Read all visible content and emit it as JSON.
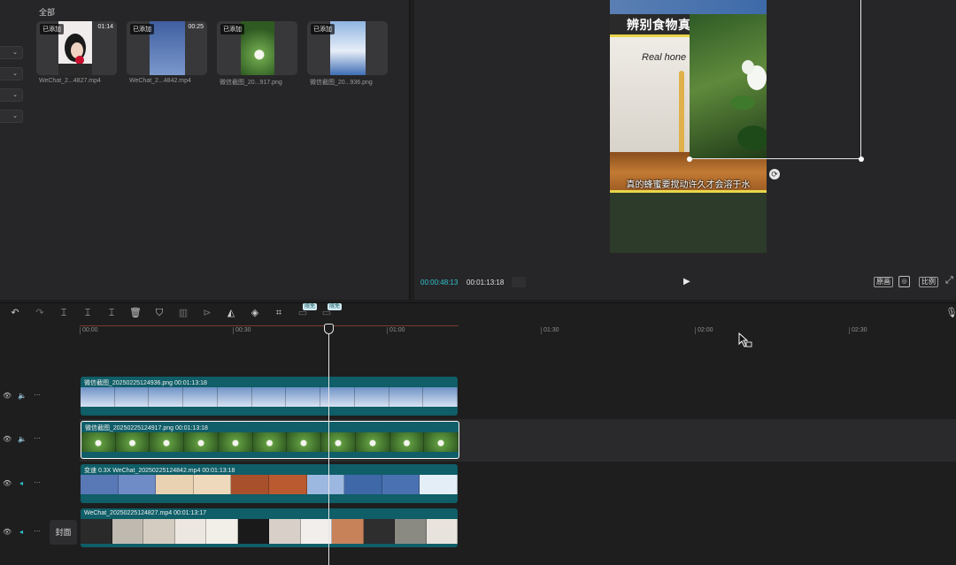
{
  "media": {
    "section_title": "全部",
    "items": [
      {
        "badge": "已添加",
        "duration": "01:14",
        "name": "WeChat_2...4827.mp4"
      },
      {
        "badge": "已添加",
        "duration": "00:25",
        "name": "WeChat_2...4842.mp4"
      },
      {
        "badge": "已添加",
        "duration": "",
        "name": "微信截图_20...917.png"
      },
      {
        "badge": "已添加",
        "duration": "",
        "name": "微信截图_20...936.png"
      }
    ]
  },
  "preview": {
    "frame_title": "辨别食物真",
    "frame_overlay_text": "Real hone",
    "subtitle": "真的蜂蜜要搅动许久才会溶于水",
    "current_time": "00:00:48:13",
    "total_time": "00:01:13:18",
    "buttons": {
      "full": "原画",
      "ratio": "比例"
    }
  },
  "toolbar": {
    "badge_1": "限免",
    "badge_2": "限免"
  },
  "ruler": {
    "ticks": [
      "00:00",
      "00:30",
      "01:00",
      "01:30",
      "02:00",
      "02:30"
    ]
  },
  "tracks": [
    {
      "label": "微信截图_20250225124936.png   00:01:13:18"
    },
    {
      "label": "微信截图_20250225124917.png   00:01:13:18"
    },
    {
      "label": "变速 0.3X   WeChat_20250225124842.mp4   00:01:13:18"
    },
    {
      "label": "WeChat_20250225124827.mp4   00:01:13:17"
    }
  ],
  "cover_label": "封面",
  "colors": {
    "accent": "#2fc4cf",
    "clip": "#0f5e68"
  }
}
